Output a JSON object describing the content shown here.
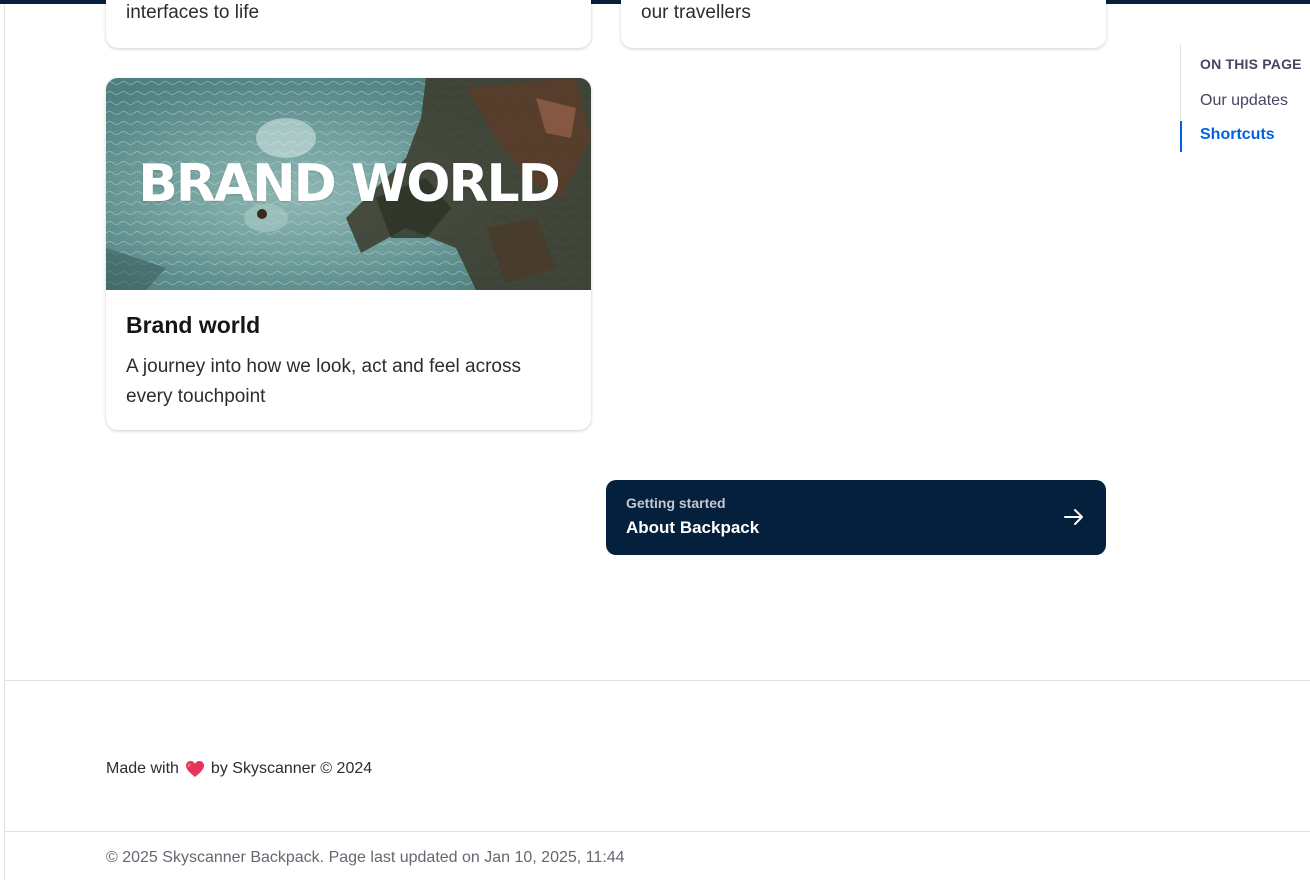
{
  "cards": {
    "top_left": {
      "description_tail": "interfaces to life"
    },
    "top_right": {
      "description_tail": "our travellers"
    },
    "brand_world": {
      "image_overlay_text": "BRAND WORLD",
      "title": "Brand world",
      "description": "A journey into how we look, act and feel across every touchpoint"
    }
  },
  "next_link": {
    "eyebrow": "Getting started",
    "title": "About Backpack",
    "icon": "arrow-right-icon"
  },
  "on_this_page": {
    "heading": "ON THIS PAGE",
    "items": [
      {
        "label": "Our updates",
        "active": false
      },
      {
        "label": "Shortcuts",
        "active": true
      }
    ]
  },
  "footer": {
    "made_with_prefix": "Made with",
    "heart_icon": "heart-icon",
    "made_with_suffix": "by Skyscanner © 2024",
    "copyright": "© 2025 Skyscanner Backpack. Page last updated on Jan 10, 2025, 11:44"
  },
  "colors": {
    "navy": "#05203c",
    "accent_blue": "#0062e3",
    "heart": "#e7345a"
  }
}
